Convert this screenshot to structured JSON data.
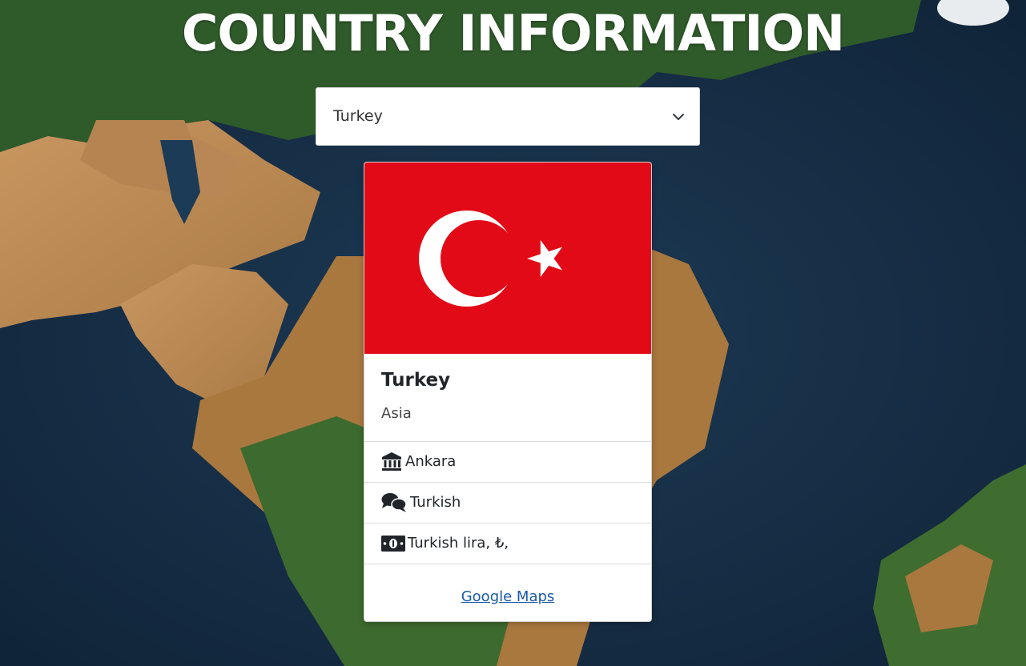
{
  "header": {
    "title": "COUNTRY INFORMATION"
  },
  "country_select": {
    "selected": "Turkey",
    "icon": "chevron-down-icon"
  },
  "card": {
    "flag_icon": "turkey-flag",
    "name": "Turkey",
    "region": "Asia",
    "details": [
      {
        "icon": "landmark-icon",
        "value": "Ankara"
      },
      {
        "icon": "comments-icon",
        "value": "Turkish"
      },
      {
        "icon": "money-bill-icon",
        "value": "Turkish lira, ₺,"
      }
    ],
    "link_label": "Google Maps"
  },
  "colors": {
    "flag_red": "#E30A17",
    "text_dark": "#212529",
    "link": "#1A5AA8",
    "white": "#FFFFFF"
  }
}
